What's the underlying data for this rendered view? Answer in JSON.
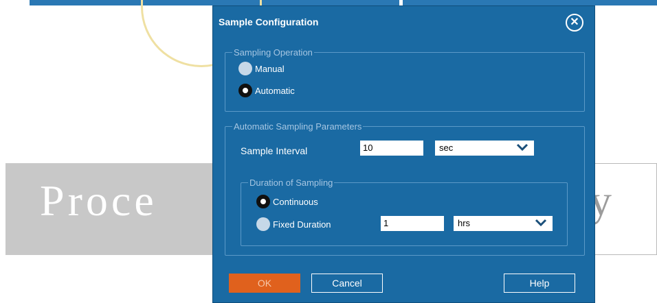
{
  "background": {
    "banner_text_left": "Proce",
    "banner_text_right": "y"
  },
  "dialog": {
    "title": "Sample Configuration",
    "sampling_operation": {
      "legend": "Sampling Operation",
      "options": [
        {
          "label": "Manual",
          "selected": false
        },
        {
          "label": "Automatic",
          "selected": true
        }
      ]
    },
    "auto_params": {
      "legend": "Automatic Sampling Parameters",
      "sample_interval_label": "Sample Interval",
      "sample_interval_value": "10",
      "sample_interval_unit": "sec",
      "duration": {
        "legend": "Duration of Sampling",
        "continuous_label": "Continuous",
        "continuous_selected": true,
        "fixed_label": "Fixed Duration",
        "fixed_selected": false,
        "fixed_value": "1",
        "fixed_unit": "hrs"
      }
    },
    "buttons": {
      "ok": "OK",
      "cancel": "Cancel",
      "help": "Help"
    }
  },
  "colors": {
    "dialog_bg": "#1a6aa3",
    "ok_button": "#e0611d",
    "banner_gray": "#c8c8c8"
  }
}
